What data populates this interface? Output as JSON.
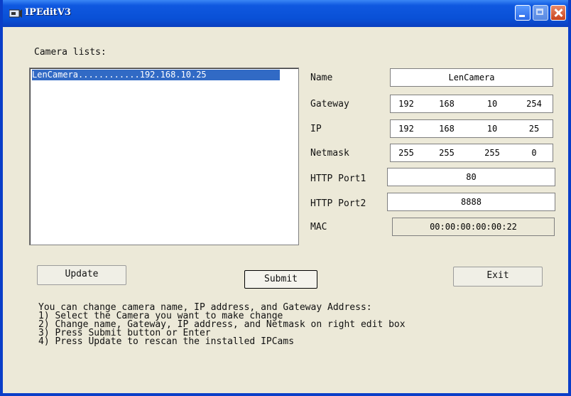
{
  "window": {
    "title": "IPEditV3",
    "accent": "#0950d6"
  },
  "camera_list": {
    "label": "Camera lists:",
    "items": [
      {
        "text": "LenCamera............192.168.10.25",
        "selected": true
      }
    ]
  },
  "form": {
    "name": {
      "label": "Name",
      "value": "LenCamera"
    },
    "gateway": {
      "label": "Gateway",
      "octets": [
        "192",
        "168",
        "10",
        "254"
      ]
    },
    "ip": {
      "label": "IP",
      "octets": [
        "192",
        "168",
        "10",
        "25"
      ]
    },
    "netmask": {
      "label": "Netmask",
      "octets": [
        "255",
        "255",
        "255",
        "0"
      ]
    },
    "http_port1": {
      "label": "HTTP Port1",
      "value": "80"
    },
    "http_port2": {
      "label": "HTTP Port2",
      "value": "8888"
    },
    "mac": {
      "label": "MAC",
      "value": "00:00:00:00:00:22"
    }
  },
  "buttons": {
    "update": "Update",
    "submit": "Submit",
    "exit": "Exit"
  },
  "help": {
    "lines": [
      "You can change camera name, IP address, and Gateway Address:",
      "1) Select the Camera you want to make change",
      "2) Change name, Gateway, IP address, and Netmask on right edit box",
      "3) Press Submit button or Enter",
      "4) Press Update to rescan the installed IPCams"
    ]
  }
}
